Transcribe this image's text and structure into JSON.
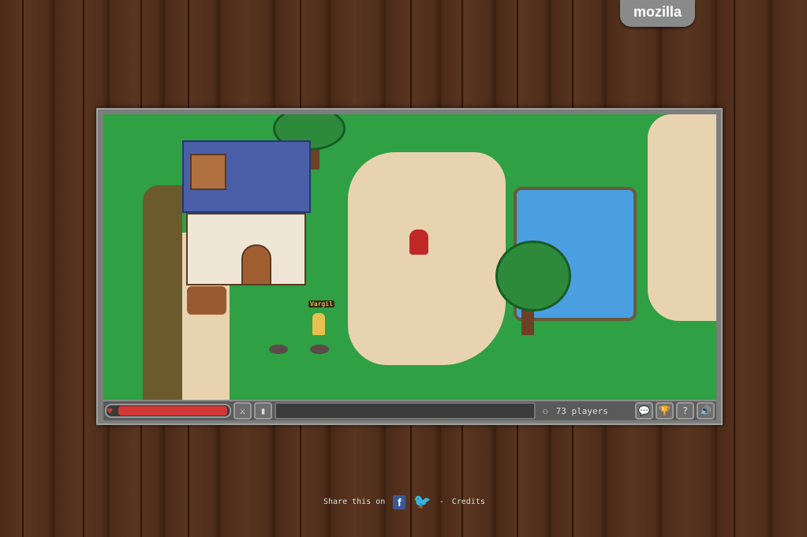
{
  "brand": "mozilla",
  "game": {
    "player_name": "Vargil",
    "health_percent": 100,
    "player_count_label": "73 players"
  },
  "hud": {
    "weapon_icon": "sword-icon",
    "armor_icon": "armor-icon",
    "buttons": [
      "chat-icon",
      "achievements-icon",
      "help-icon",
      "sound-icon"
    ]
  },
  "footer": {
    "share_text": "Share this on",
    "facebook": "f",
    "twitter_icon": "twitter-bird-icon",
    "separator": "-",
    "credits": "Credits"
  },
  "colors": {
    "grass": "#2fa043",
    "sand": "#e8d3b0",
    "water": "#4a9fe0",
    "health": "#d03838"
  }
}
